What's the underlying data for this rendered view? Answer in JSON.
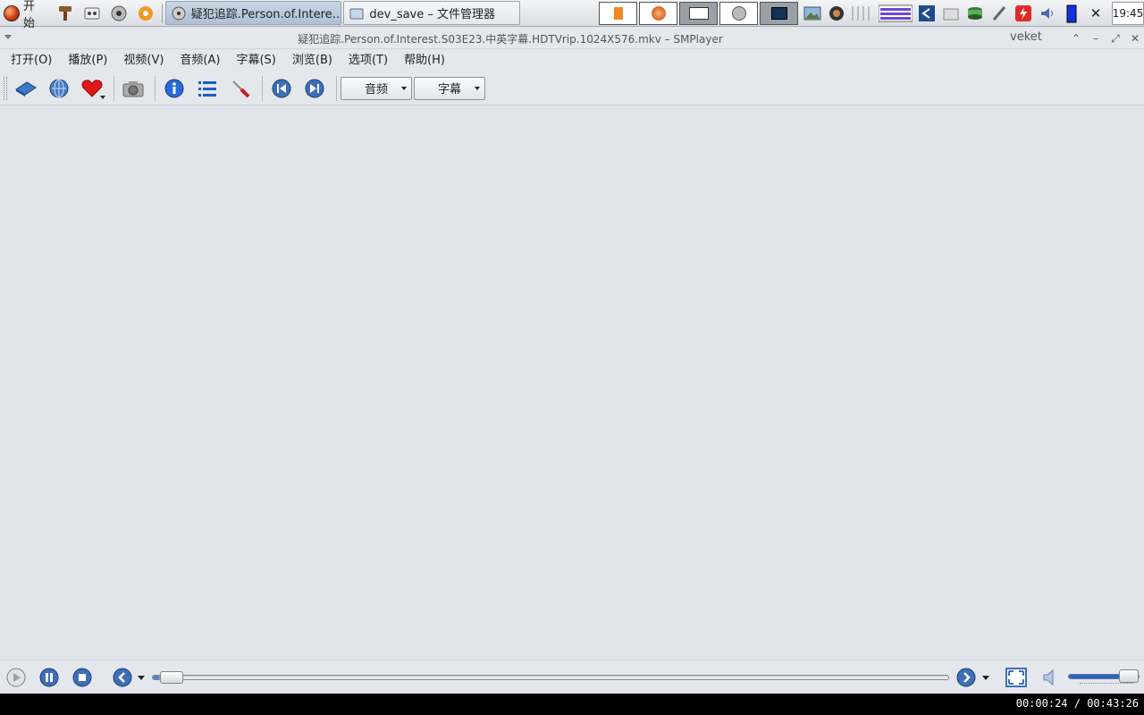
{
  "taskbar": {
    "start_label": "开始",
    "tasks": [
      {
        "label": "疑犯追踪.Person.of.Intere…",
        "icon": "smplayer-icon",
        "active": true
      },
      {
        "label": "dev_save – 文件管理器",
        "icon": "folder-icon",
        "active": false
      }
    ],
    "clock": "19:45"
  },
  "window": {
    "title": "疑犯追踪.Person.of.Interest.S03E23.中英字幕.HDTVrip.1024X576.mkv – SMPlayer",
    "user": "veket"
  },
  "menubar": {
    "items": [
      "打开(O)",
      "播放(P)",
      "视频(V)",
      "音频(A)",
      "字幕(S)",
      "浏览(B)",
      "选项(T)",
      "帮助(H)"
    ]
  },
  "toolbar": {
    "audio_label": "音频",
    "subtitle_label": "字幕"
  },
  "player": {
    "position": "00:00:24",
    "duration": "00:43:26",
    "time_display": "00:00:24 / 00:43:26",
    "progress_fraction": 0.009,
    "volume_fraction": 0.95
  },
  "colors": {
    "accent": "#2f61b5",
    "background": "#e1e5eb",
    "statusbar": "#000000"
  }
}
